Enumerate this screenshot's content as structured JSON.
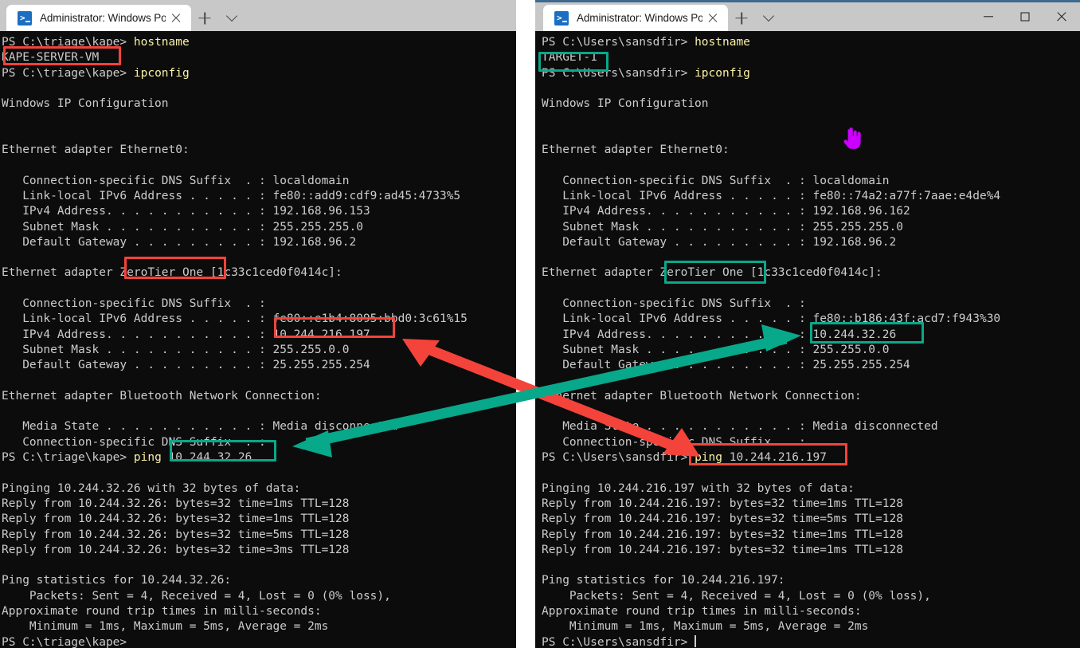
{
  "colors": {
    "accent_red": "#f4433a",
    "accent_green": "#08a88a",
    "console_bg": "#0c0c0c",
    "console_fg": "#cccccc",
    "command_yellow": "#f9f1a5",
    "titlebar_bg": "#c8c8c8",
    "tab_active_bg": "#ffffff",
    "cursor_magenta": "#cc00ff",
    "window_top_border": "#3d6a8e"
  },
  "left_window": {
    "titlebar": {
      "tab": {
        "icon": "powershell-icon",
        "title": "Administrator: Windows PowerS",
        "close_icon": "close-icon"
      },
      "new_tab_icon": "plus-icon",
      "dropdown_icon": "chevron-down-icon"
    },
    "prompt": "PS C:\\triage\\kape>",
    "hostname": "KAPE-SERVER-VM",
    "lines": [
      {
        "type": "prompt",
        "prompt": "PS C:\\triage\\kape> ",
        "command": "hostname"
      },
      {
        "type": "out",
        "text": "KAPE-SERVER-VM"
      },
      {
        "type": "prompt",
        "prompt": "PS C:\\triage\\kape> ",
        "command": "ipconfig"
      },
      {
        "type": "out",
        "text": ""
      },
      {
        "type": "out",
        "text": "Windows IP Configuration"
      },
      {
        "type": "out",
        "text": ""
      },
      {
        "type": "out",
        "text": ""
      },
      {
        "type": "out",
        "text": "Ethernet adapter Ethernet0:"
      },
      {
        "type": "out",
        "text": ""
      },
      {
        "type": "out",
        "text": "   Connection-specific DNS Suffix  . : localdomain"
      },
      {
        "type": "out",
        "text": "   Link-local IPv6 Address . . . . . : fe80::add9:cdf9:ad45:4733%5"
      },
      {
        "type": "out",
        "text": "   IPv4 Address. . . . . . . . . . . : 192.168.96.153"
      },
      {
        "type": "out",
        "text": "   Subnet Mask . . . . . . . . . . . : 255.255.255.0"
      },
      {
        "type": "out",
        "text": "   Default Gateway . . . . . . . . . : 192.168.96.2"
      },
      {
        "type": "out",
        "text": ""
      },
      {
        "type": "out",
        "text": "Ethernet adapter ZeroTier One [1c33c1ced0f0414c]:"
      },
      {
        "type": "out",
        "text": ""
      },
      {
        "type": "out",
        "text": "   Connection-specific DNS Suffix  . :"
      },
      {
        "type": "out",
        "text": "   Link-local IPv6 Address . . . . . : fe80::e1b4:8095:bbd0:3c61%15"
      },
      {
        "type": "out",
        "text": "   IPv4 Address. . . . . . . . . . . : 10.244.216.197"
      },
      {
        "type": "out",
        "text": "   Subnet Mask . . . . . . . . . . . : 255.255.0.0"
      },
      {
        "type": "out",
        "text": "   Default Gateway . . . . . . . . . : 25.255.255.254"
      },
      {
        "type": "out",
        "text": ""
      },
      {
        "type": "out",
        "text": "Ethernet adapter Bluetooth Network Connection:"
      },
      {
        "type": "out",
        "text": ""
      },
      {
        "type": "out",
        "text": "   Media State . . . . . . . . . . . : Media disconnected"
      },
      {
        "type": "out",
        "text": "   Connection-specific DNS Suffix  . :"
      },
      {
        "type": "prompt",
        "prompt": "PS C:\\triage\\kape> ",
        "command": "ping",
        "args": " 10.244.32.26"
      },
      {
        "type": "out",
        "text": ""
      },
      {
        "type": "out",
        "text": "Pinging 10.244.32.26 with 32 bytes of data:"
      },
      {
        "type": "out",
        "text": "Reply from 10.244.32.26: bytes=32 time=1ms TTL=128"
      },
      {
        "type": "out",
        "text": "Reply from 10.244.32.26: bytes=32 time=1ms TTL=128"
      },
      {
        "type": "out",
        "text": "Reply from 10.244.32.26: bytes=32 time=5ms TTL=128"
      },
      {
        "type": "out",
        "text": "Reply from 10.244.32.26: bytes=32 time=3ms TTL=128"
      },
      {
        "type": "out",
        "text": ""
      },
      {
        "type": "out",
        "text": "Ping statistics for 10.244.32.26:"
      },
      {
        "type": "out",
        "text": "    Packets: Sent = 4, Received = 4, Lost = 0 (0% loss),"
      },
      {
        "type": "out",
        "text": "Approximate round trip times in milli-seconds:"
      },
      {
        "type": "out",
        "text": "    Minimum = 1ms, Maximum = 5ms, Average = 2ms"
      },
      {
        "type": "prompt",
        "prompt": "PS C:\\triage\\kape>",
        "command": ""
      }
    ],
    "highlights": [
      {
        "id": "hostname-box",
        "color": "red",
        "label": "KAPE-SERVER-VM"
      },
      {
        "id": "zerotier-adapter-box",
        "color": "red",
        "label": "ZeroTier One"
      },
      {
        "id": "local-ipv4-box",
        "color": "red",
        "label": "10.244.216.197"
      },
      {
        "id": "ping-target-box",
        "color": "green",
        "label": "10.244.32.26"
      }
    ]
  },
  "right_window": {
    "titlebar": {
      "tab": {
        "icon": "powershell-icon",
        "title": "Administrator: Windows PowerS",
        "close_icon": "close-icon"
      },
      "new_tab_icon": "plus-icon",
      "dropdown_icon": "chevron-down-icon",
      "minimize_icon": "minimize-icon",
      "maximize_icon": "maximize-icon",
      "close_icon": "close-icon"
    },
    "prompt": "PS C:\\Users\\sansdfir>",
    "hostname": "TARGET-1",
    "lines": [
      {
        "type": "prompt",
        "prompt": "PS C:\\Users\\sansdfir> ",
        "command": "hostname"
      },
      {
        "type": "out",
        "text": "TARGET-1"
      },
      {
        "type": "prompt",
        "prompt": "PS C:\\Users\\sansdfir> ",
        "command": "ipconfig"
      },
      {
        "type": "out",
        "text": ""
      },
      {
        "type": "out",
        "text": "Windows IP Configuration"
      },
      {
        "type": "out",
        "text": ""
      },
      {
        "type": "out",
        "text": ""
      },
      {
        "type": "out",
        "text": "Ethernet adapter Ethernet0:"
      },
      {
        "type": "out",
        "text": ""
      },
      {
        "type": "out",
        "text": "   Connection-specific DNS Suffix  . : localdomain"
      },
      {
        "type": "out",
        "text": "   Link-local IPv6 Address . . . . . : fe80::74a2:a77f:7aae:e4de%4"
      },
      {
        "type": "out",
        "text": "   IPv4 Address. . . . . . . . . . . : 192.168.96.162"
      },
      {
        "type": "out",
        "text": "   Subnet Mask . . . . . . . . . . . : 255.255.255.0"
      },
      {
        "type": "out",
        "text": "   Default Gateway . . . . . . . . . : 192.168.96.2"
      },
      {
        "type": "out",
        "text": ""
      },
      {
        "type": "out",
        "text": "Ethernet adapter ZeroTier One [1c33c1ced0f0414c]:"
      },
      {
        "type": "out",
        "text": ""
      },
      {
        "type": "out",
        "text": "   Connection-specific DNS Suffix  . :"
      },
      {
        "type": "out",
        "text": "   Link-local IPv6 Address . . . . . : fe80::b186:43f:acd7:f943%30"
      },
      {
        "type": "out",
        "text": "   IPv4 Address. . . . . . . . . . . : 10.244.32.26"
      },
      {
        "type": "out",
        "text": "   Subnet Mask . . . . . . . . . . . : 255.255.0.0"
      },
      {
        "type": "out",
        "text": "   Default Gateway . . . . . . . . . : 25.255.255.254"
      },
      {
        "type": "out",
        "text": ""
      },
      {
        "type": "out",
        "text": "Ethernet adapter Bluetooth Network Connection:"
      },
      {
        "type": "out",
        "text": ""
      },
      {
        "type": "out",
        "text": "   Media State . . . . . . . . . . . : Media disconnected"
      },
      {
        "type": "out",
        "text": "   Connection-specific DNS Suffix  . :"
      },
      {
        "type": "prompt",
        "prompt": "PS C:\\Users\\sansdfir> ",
        "command": "ping",
        "args": " 10.244.216.197"
      },
      {
        "type": "out",
        "text": ""
      },
      {
        "type": "out",
        "text": "Pinging 10.244.216.197 with 32 bytes of data:"
      },
      {
        "type": "out",
        "text": "Reply from 10.244.216.197: bytes=32 time=1ms TTL=128"
      },
      {
        "type": "out",
        "text": "Reply from 10.244.216.197: bytes=32 time=5ms TTL=128"
      },
      {
        "type": "out",
        "text": "Reply from 10.244.216.197: bytes=32 time=1ms TTL=128"
      },
      {
        "type": "out",
        "text": "Reply from 10.244.216.197: bytes=32 time=1ms TTL=128"
      },
      {
        "type": "out",
        "text": ""
      },
      {
        "type": "out",
        "text": "Ping statistics for 10.244.216.197:"
      },
      {
        "type": "out",
        "text": "    Packets: Sent = 4, Received = 4, Lost = 0 (0% loss),"
      },
      {
        "type": "out",
        "text": "Approximate round trip times in milli-seconds:"
      },
      {
        "type": "out",
        "text": "    Minimum = 1ms, Maximum = 5ms, Average = 2ms"
      },
      {
        "type": "prompt",
        "prompt": "PS C:\\Users\\sansdfir> ",
        "command": "",
        "caret": true
      }
    ],
    "highlights": [
      {
        "id": "hostname-box",
        "color": "green",
        "label": "TARGET-1"
      },
      {
        "id": "zerotier-adapter-box",
        "color": "green",
        "label": "ZeroTier One"
      },
      {
        "id": "local-ipv4-box",
        "color": "green",
        "label": "10.244.32.26"
      },
      {
        "id": "ping-target-box",
        "color": "red",
        "label": "ping 10.244.216.197"
      }
    ]
  },
  "annotations": {
    "red_arrow": {
      "color": "#f4433a",
      "from_label": "10.244.216.197 (KAPE-SERVER-VM ZeroTier IPv4)",
      "to_label": "ping 10.244.216.197 (run on TARGET-1)"
    },
    "green_arrow": {
      "color": "#08a88a",
      "from_label": "10.244.32.26 (TARGET-1 ZeroTier IPv4)",
      "to_label": "ping 10.244.32.26 (run on KAPE-SERVER-VM)"
    },
    "cursor": {
      "icon": "pointing-hand-cursor",
      "color": "#cc00ff"
    }
  }
}
